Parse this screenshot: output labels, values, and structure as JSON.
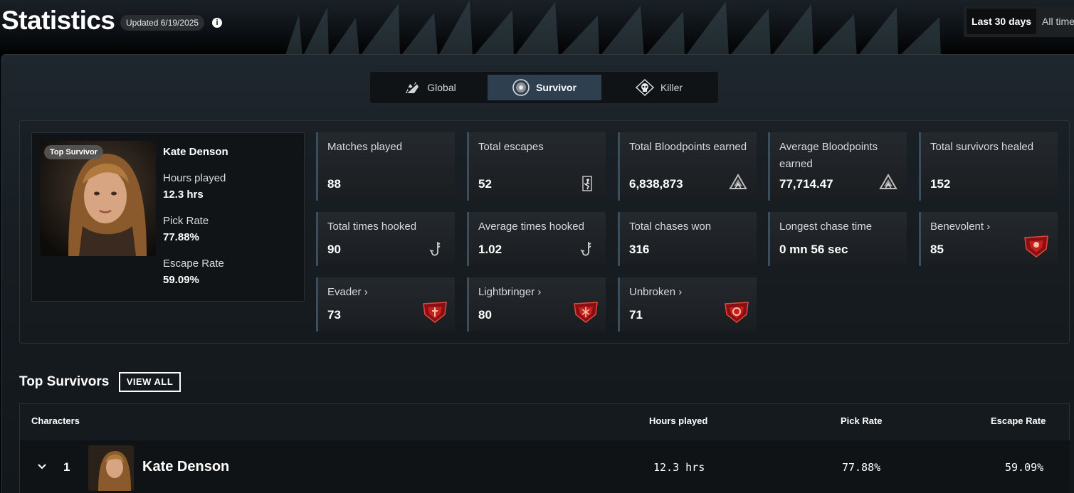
{
  "header": {
    "title": "Statistics",
    "updated": "Updated 6/19/2025",
    "info_icon": "info-icon",
    "range_options": [
      {
        "label": "Last 30 days",
        "active": true
      },
      {
        "label": "All time",
        "active": false
      }
    ]
  },
  "tabs": [
    {
      "label": "Global",
      "icon": "global-icon",
      "active": false
    },
    {
      "label": "Survivor",
      "icon": "survivor-icon",
      "active": true
    },
    {
      "label": "Killer",
      "icon": "killer-skull-icon",
      "active": false
    }
  ],
  "top_survivor": {
    "badge": "Top Survivor",
    "name": "Kate Denson",
    "hours_label": "Hours played",
    "hours_value": "12.3 hrs",
    "pick_label": "Pick Rate",
    "pick_value": "77.88%",
    "escape_label": "Escape Rate",
    "escape_value": "59.09%"
  },
  "stats": [
    {
      "label": "Matches played",
      "value": "88",
      "icon": ""
    },
    {
      "label": "Total escapes",
      "value": "52",
      "icon": "escape-icon"
    },
    {
      "label": "Total Bloodpoints earned",
      "value": "6,838,873",
      "icon": "bloodpoints-icon"
    },
    {
      "label": "Average Bloodpoints earned",
      "value": "77,714.47",
      "icon": "bloodpoints-icon"
    },
    {
      "label": "Total survivors healed",
      "value": "152",
      "icon": ""
    },
    {
      "label": "Total times hooked",
      "value": "90",
      "icon": "hook-icon"
    },
    {
      "label": "Average times hooked",
      "value": "1.02",
      "icon": "hook-icon"
    },
    {
      "label": "Total chases won",
      "value": "316",
      "icon": ""
    },
    {
      "label": "Longest chase time",
      "value": "0 mn 56 sec",
      "icon": ""
    },
    {
      "label": "Benevolent",
      "value": "85",
      "icon": "emblem-icon"
    },
    {
      "label": "Evader",
      "value": "73",
      "icon": "emblem-icon"
    },
    {
      "label": "Lightbringer",
      "value": "80",
      "icon": "emblem-icon"
    },
    {
      "label": "Unbroken",
      "value": "71",
      "icon": "emblem-icon"
    }
  ],
  "top_survivors": {
    "title": "Top Survivors",
    "view_all": "VIEW ALL",
    "columns": [
      "Characters",
      "Hours played",
      "Pick Rate",
      "Escape Rate"
    ],
    "rows": [
      {
        "rank": "1",
        "name": "Kate Denson",
        "hours": "12.3 hrs",
        "pick": "77.88%",
        "escape": "59.09%"
      }
    ]
  },
  "colors": {
    "active_tab": "#2e4050",
    "emblem_red": "#b3171b",
    "card_accent": "#3a4f5e"
  }
}
